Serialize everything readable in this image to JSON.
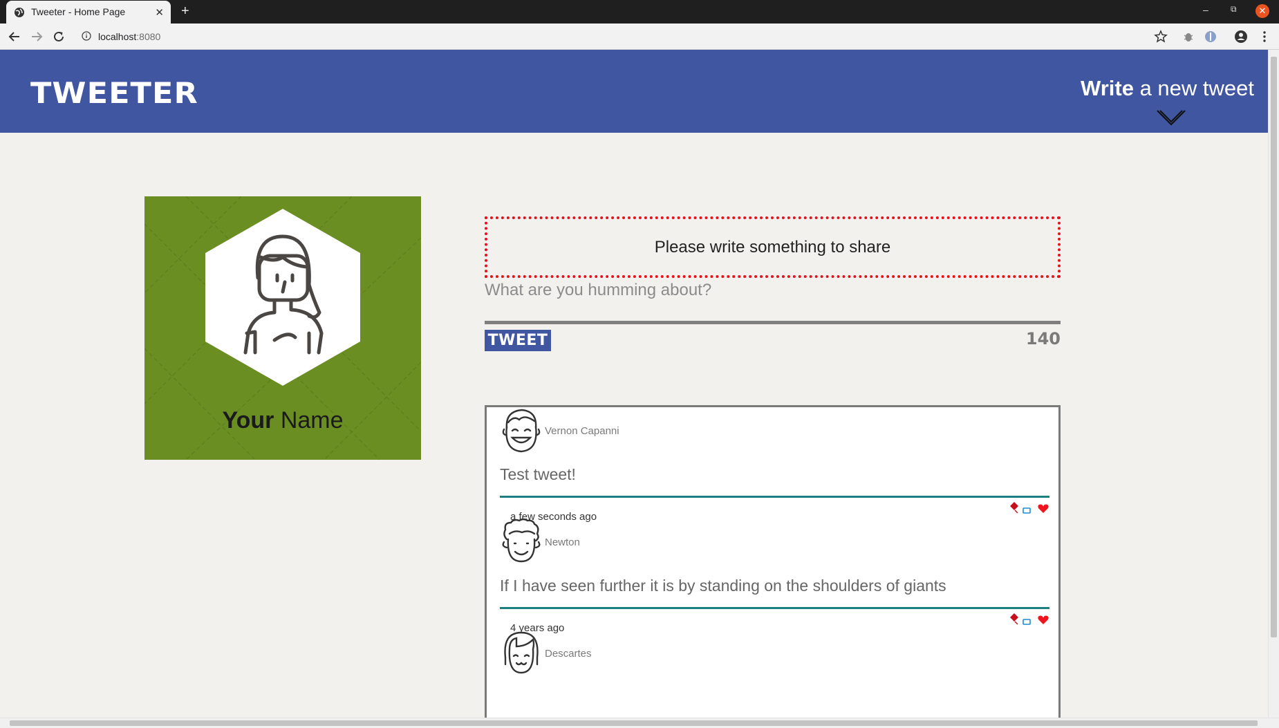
{
  "browser": {
    "tab_title": "Tweeter - Home Page",
    "new_tab": "+",
    "url_host": "localhost",
    "url_port": ":8080"
  },
  "header": {
    "brand": "TWEETER",
    "compose_bold": "Write",
    "compose_rest": " a new tweet"
  },
  "profile": {
    "first_name": "Your",
    "last_name": " Name"
  },
  "compose": {
    "error_message": "Please write something to share",
    "placeholder": "What are you humming about?",
    "button_label": "TWEET",
    "counter": "140"
  },
  "tweets": [
    {
      "author": "Vernon Capanni",
      "text": "Test tweet!",
      "time": "a few seconds ago",
      "avatar": "smiling-man-icon"
    },
    {
      "author": "Newton",
      "text": "If I have seen further it is by standing on the shoulders of giants",
      "time": "4 years ago",
      "avatar": "curly-hair-man-icon"
    },
    {
      "author": "Descartes",
      "text": "",
      "time": "",
      "avatar": "bob-hair-person-icon"
    }
  ],
  "colors": {
    "header_bg": "#4056a1",
    "page_bg": "#f3f1ee",
    "profile_bg": "#6b8e23",
    "error_border": "#e8101a",
    "tweet_rule": "#1a7f83"
  }
}
